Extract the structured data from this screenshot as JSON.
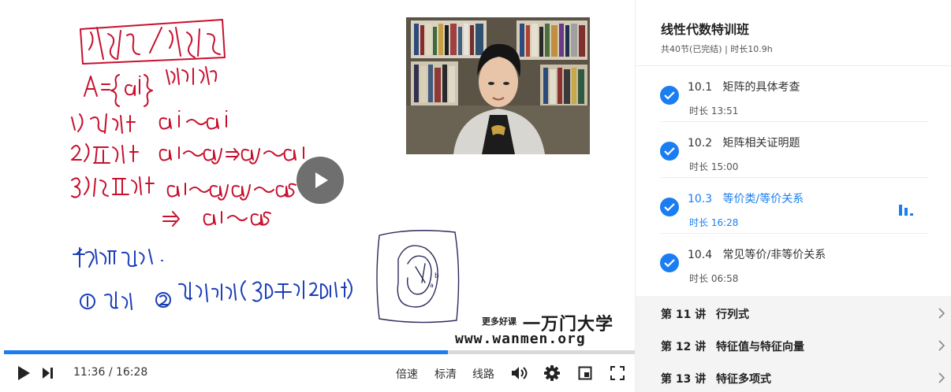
{
  "player": {
    "current_time": "11:36",
    "separator": "/",
    "duration": "16:28",
    "progress_fraction": 0.704,
    "speed_label": "倍速",
    "quality_label": "标清",
    "route_label": "线路",
    "watermark": {
      "small_text": "更多好课",
      "brand_text": "一万门大学",
      "url_text": "www.wanmen.org"
    },
    "icons": [
      "play-icon",
      "next-icon",
      "volume-icon",
      "gear-icon",
      "picture-in-picture-icon",
      "fullscreen-icon",
      "big-play-icon"
    ]
  },
  "course": {
    "title": "线性代数特训班",
    "meta": "共40节(已完结) | 时长10.9h"
  },
  "lessons": [
    {
      "number": "10.1",
      "title": "矩阵的具体考查",
      "duration": "时长 13:51",
      "completed": true,
      "active": false
    },
    {
      "number": "10.2",
      "title": "矩阵相关证明题",
      "duration": "时长 15:00",
      "completed": true,
      "active": false
    },
    {
      "number": "10.3",
      "title": "等价类/等价关系",
      "duration": "时长 16:28",
      "completed": true,
      "active": true
    },
    {
      "number": "10.4",
      "title": "常见等价/非等价关系",
      "duration": "时长 06:58",
      "completed": true,
      "active": false
    }
  ],
  "chapters": [
    {
      "number": "第 11 讲",
      "name": "行列式"
    },
    {
      "number": "第 12 讲",
      "name": "特征值与特征向量"
    },
    {
      "number": "第 13 讲",
      "name": "特征多项式"
    }
  ],
  "colors": {
    "accent": "#1a7ef2",
    "ink_red": "#c8102e",
    "ink_blue": "#1c3fb8"
  }
}
